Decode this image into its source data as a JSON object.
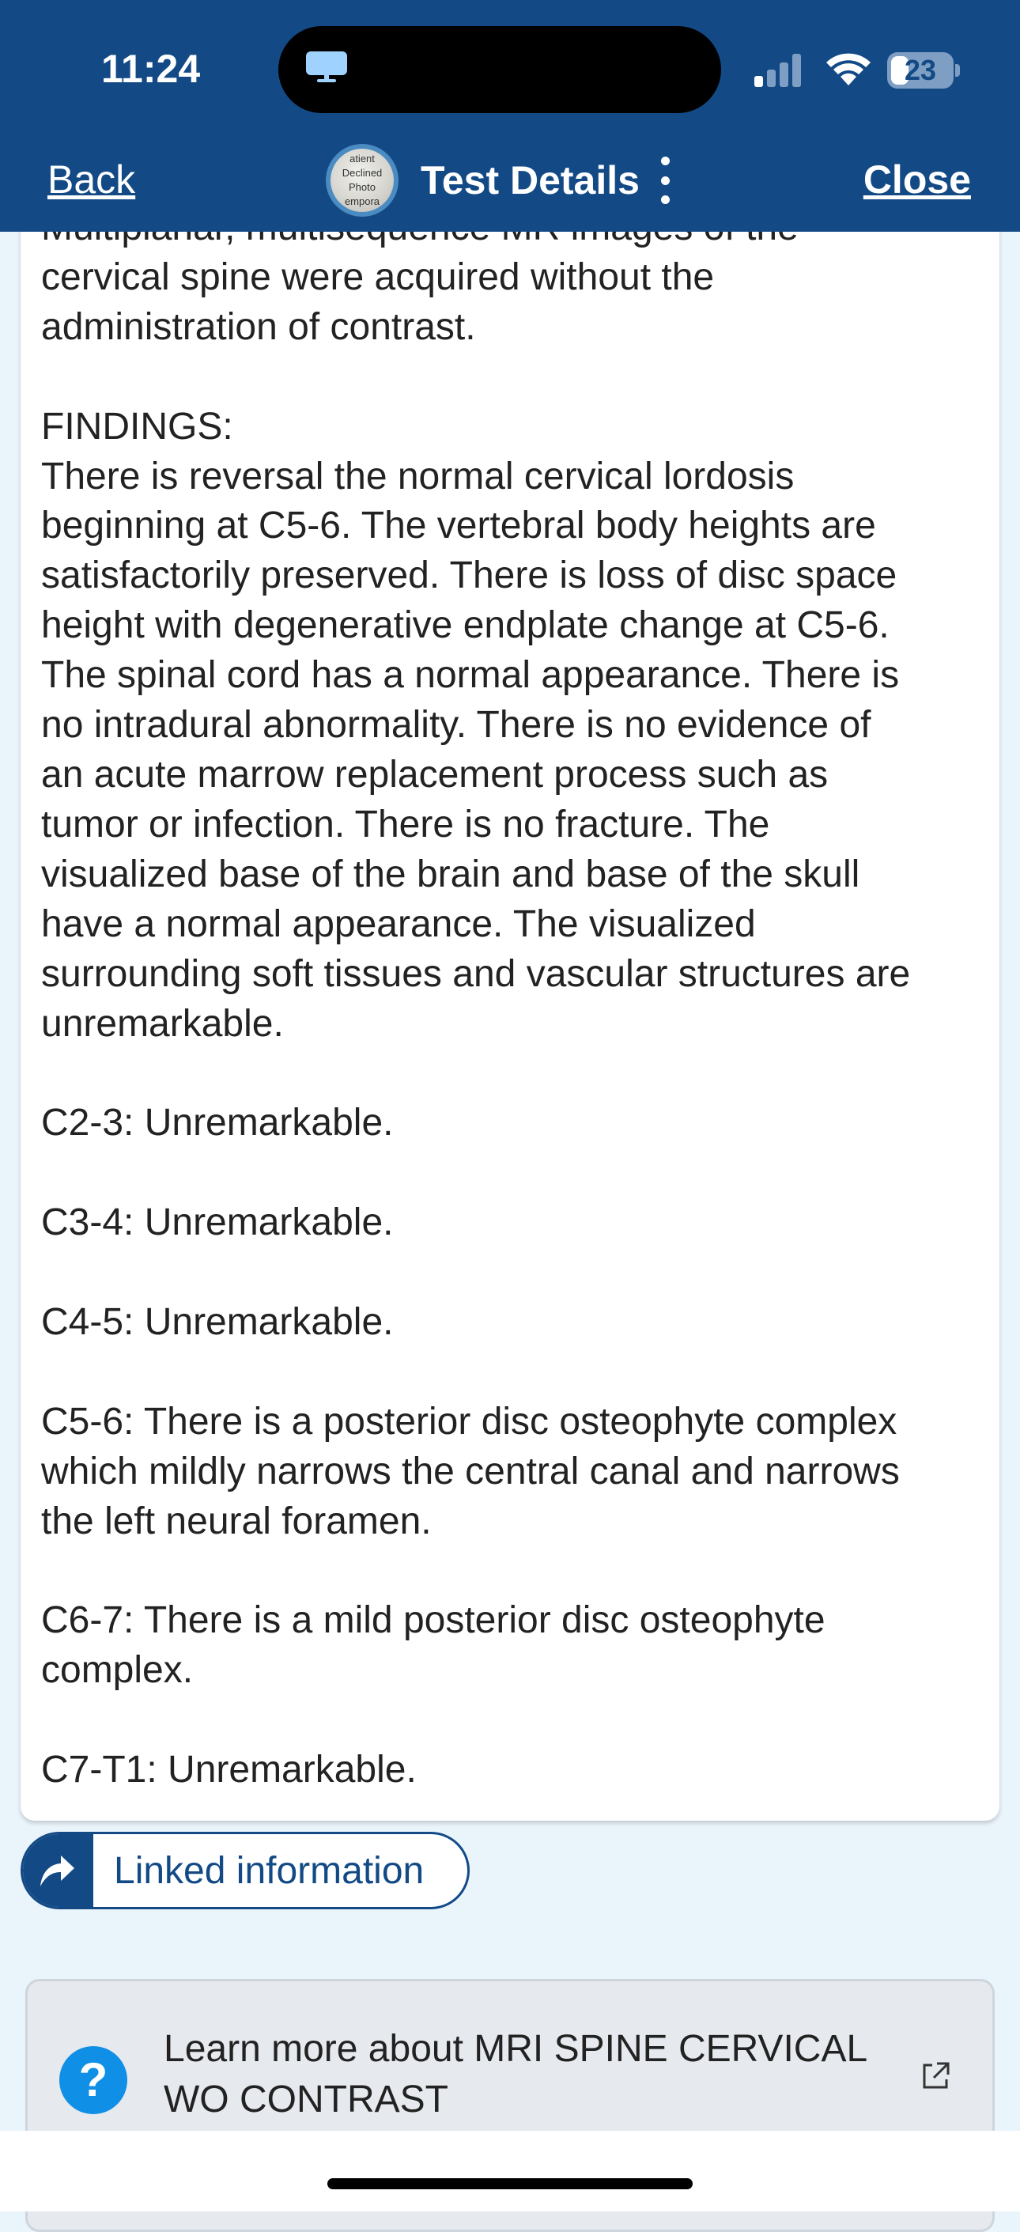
{
  "status_bar": {
    "time": "11:24",
    "battery": "23"
  },
  "nav": {
    "back_label": "Back",
    "title": "Test Details",
    "close_label": "Close",
    "avatar_text": [
      "atient",
      "Declined",
      "Photo",
      "empora"
    ]
  },
  "report": {
    "text": "Multiplanar, multisequence MR images of the\ncervical spine were acquired without the\nadministration of contrast.\n\nFINDINGS:\nThere is reversal the normal cervical lordosis\nbeginning at C5-6. The vertebral body heights are\nsatisfactorily preserved. There is loss of disc space\nheight with degenerative endplate change at C5-6.\nThe spinal cord has a normal appearance. There is\nno intradural abnormality. There is no evidence of\nan acute marrow replacement process such as\ntumor or infection. There is no fracture. The\nvisualized base of the brain and base of the skull\nhave a normal appearance. The visualized\nsurrounding soft tissues and vascular structures are\nunremarkable.\n\nC2-3: Unremarkable.\n\nC3-4: Unremarkable.\n\nC4-5: Unremarkable.\n\nC5-6: There is a posterior disc osteophyte complex\nwhich mildly narrows the central canal and narrows\nthe left neural foramen.\n\nC6-7: There is a mild posterior disc osteophyte\ncomplex.\n\nC7-T1: Unremarkable."
  },
  "linked": {
    "label": "Linked information",
    "icon": "share-arrow-icon"
  },
  "learn_more": {
    "text": "Learn more about MRI SPINE CERVICAL WO CONTRAST",
    "icon": "help-icon",
    "ext_icon": "external-link-icon"
  },
  "colors": {
    "header": "#134a86",
    "page_bg": "#eaf4fb",
    "help_icon": "#0f8fe6"
  }
}
